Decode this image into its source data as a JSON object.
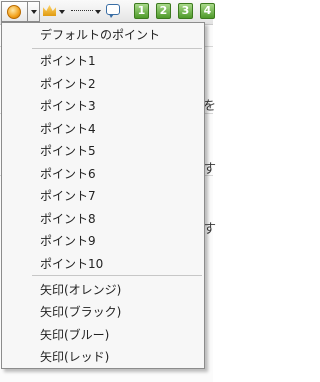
{
  "toolbar": {
    "buttons": [
      {
        "name": "point-style-button",
        "icon": "sun-icon"
      },
      {
        "name": "crown-button",
        "icon": "crown-icon"
      },
      {
        "name": "line-style-button",
        "icon": "dashed-line-icon"
      },
      {
        "name": "comment-button",
        "icon": "speech-bubble-icon"
      }
    ],
    "numbers": [
      "1",
      "2",
      "3",
      "4"
    ],
    "accent": "#4e9a2a"
  },
  "menu": {
    "default_label": "デフォルトのポイント",
    "points": [
      "ポイント1",
      "ポイント2",
      "ポイント3",
      "ポイント4",
      "ポイント5",
      "ポイント6",
      "ポイント7",
      "ポイント8",
      "ポイント9",
      "ポイント10"
    ],
    "arrows": [
      "矢印(オレンジ)",
      "矢印(ブラック)",
      "矢印(ブルー)",
      "矢印(レッド)"
    ]
  },
  "background_glyphs": [
    "を",
    "す",
    "す"
  ]
}
